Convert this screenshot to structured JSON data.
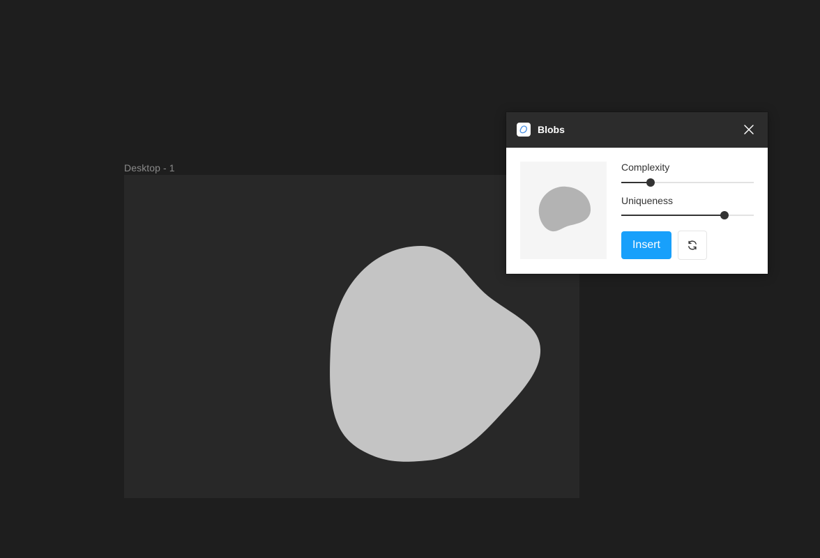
{
  "canvas": {
    "background": "#1e1e1e",
    "frame_label": "Desktop - 1",
    "frame_background": "#282828",
    "blob_color": "#c4c4c4"
  },
  "plugin": {
    "title": "Blobs",
    "icon": "blob-logo-icon",
    "close_icon": "close-icon",
    "preview_blob_color": "#b3b3b3",
    "sliders": [
      {
        "label": "Complexity",
        "value_percent": 22
      },
      {
        "label": "Uniqueness",
        "value_percent": 78
      }
    ],
    "insert_label": "Insert",
    "insert_color": "#18a0fb",
    "refresh_icon": "refresh-icon"
  }
}
